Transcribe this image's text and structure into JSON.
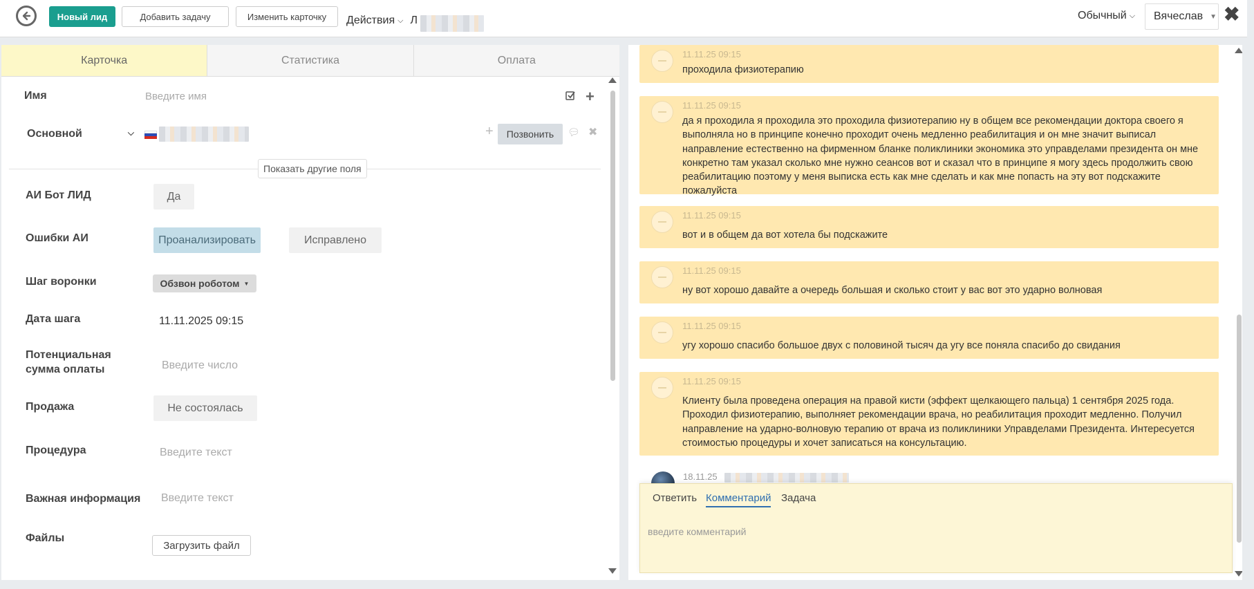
{
  "topbar": {
    "new_lead": "Новый лид",
    "add_task": "Добавить задачу",
    "edit_card": "Изменить карточку",
    "actions": "Действия",
    "actions_tail": "Л",
    "mode": "Обычный",
    "user": "Вячеслав",
    "close": "✖"
  },
  "tabs": [
    "Карточка",
    "Статистика",
    "Оплата"
  ],
  "card": {
    "name_label": "Имя",
    "name_placeholder": "Введите имя",
    "phone_type": "Основной",
    "call_button": "Позвонить",
    "show_more": "Показать другие поля",
    "fields": {
      "ai_bot_label": "АИ Бот ЛИД",
      "ai_bot_value": "Да",
      "ai_errors_label": "Ошибки АИ",
      "analyze_button": "Проанализировать",
      "fixed_button": "Исправлено",
      "funnel_step_label": "Шаг воронки",
      "funnel_step_value": "Обзвон роботом",
      "step_date_label": "Дата шага",
      "step_date_value": "11.11.2025 09:15",
      "potential_sum_label_1": "Потенциальная",
      "potential_sum_label_2": "сумма оплаты",
      "potential_sum_placeholder": "Введите число",
      "sale_label": "Продажа",
      "sale_value": "Не состоялась",
      "procedure_label": "Процедура",
      "procedure_placeholder": "Введите текст",
      "important_label": "Важная информация",
      "important_placeholder": "Введите текст",
      "files_label": "Файлы",
      "upload_button": "Загрузить файл"
    }
  },
  "messages": [
    {
      "time": "11.11.25 09:15",
      "text": "проходила физиотерапию"
    },
    {
      "time": "11.11.25 09:15",
      "text": "да я проходила я проходила это проходила физиотерапию ну в общем все рекомендации доктора своего я выполняла но в принципе конечно проходит очень медленно реабилитация и он мне значит выписал направление естественно на фирменном бланке поликлиники экономика это управделами президента он мне конкретно там указал сколько мне нужно сеансов вот и сказал что в принципе я могу здесь продолжить свою реабилитацию поэтому у меня выписка есть как мне сделать и как мне попасть на эту вот подскажите пожалуйста"
    },
    {
      "time": "11.11.25 09:15",
      "text": "вот и в общем да вот хотела бы подскажите"
    },
    {
      "time": "11.11.25 09:15",
      "text": "ну вот хорошо давайте а очередь большая и сколько стоит у вас вот это ударно волновая"
    },
    {
      "time": "11.11.25 09:15",
      "text": "угу хорошо спасибо большое двух с половиной тысяч да угу все поняла спасибо до свидания"
    },
    {
      "time": "11.11.25 09:15",
      "text": "Клиенту была проведена операция на правой кисти (эффект щелкающего пальца) 1 сентября 2025 года. Проходил физиотерапию, выполняет рекомендации врача, но реабилитация проходит медленно. Получил направление на ударно-волновую терапию от врача из поликлиники Управделами Президента. Интересуется стоимостью процедуры и хочет записаться на консультацию."
    }
  ],
  "last_message_time": "18.11.25",
  "composer": {
    "tabs": [
      "Ответить",
      "Комментарий",
      "Задача"
    ],
    "placeholder": "введите комментарий"
  },
  "colors": {
    "accent": "#1a9e8f",
    "active_tab": "#fdf8c8",
    "message_bg": "#ffe8b0",
    "link_blue": "#2f6fb0"
  }
}
